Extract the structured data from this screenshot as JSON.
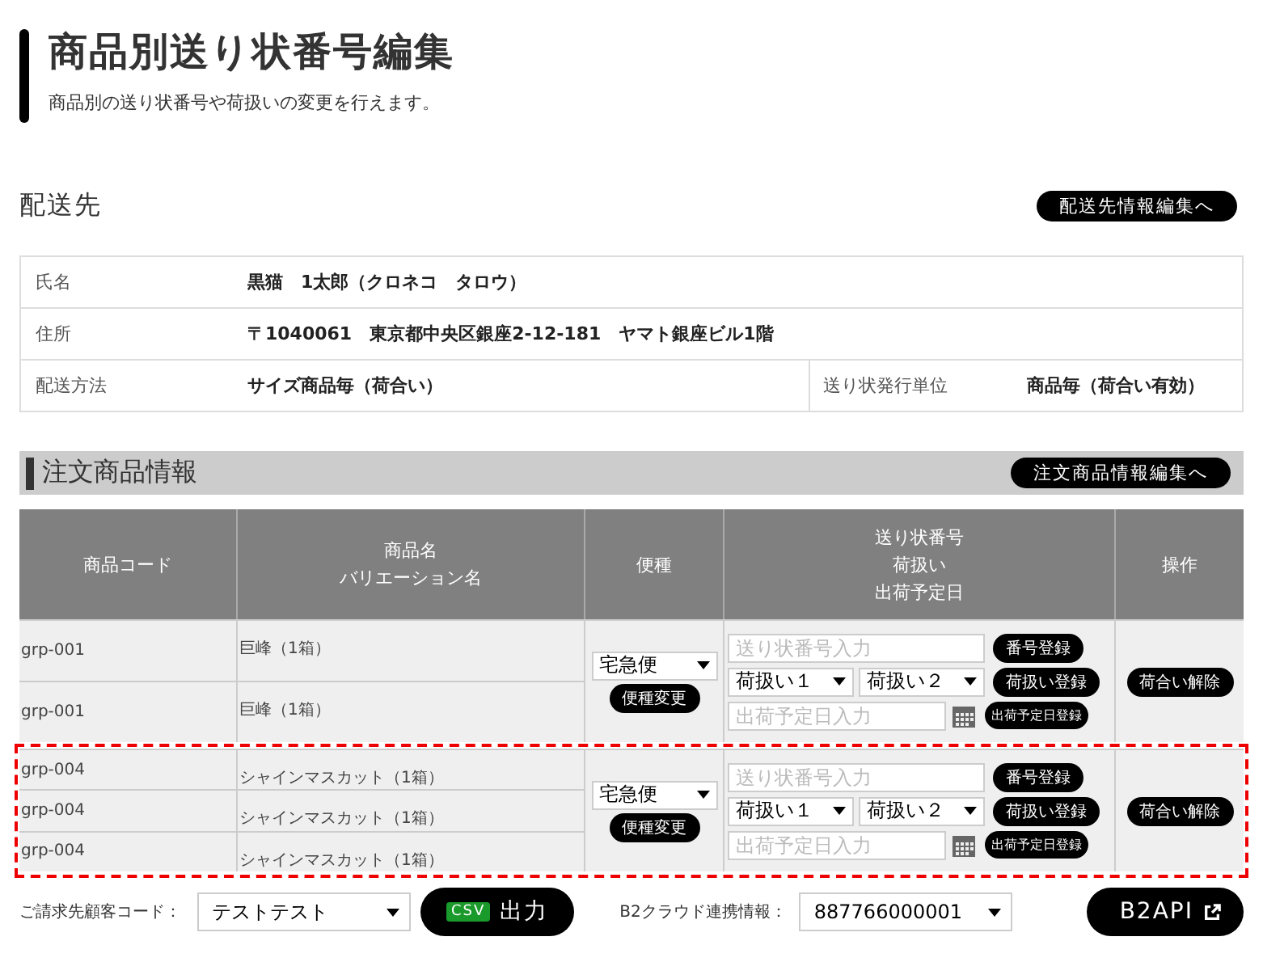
{
  "header": {
    "title": "商品別送り状番号編集",
    "subtitle": "商品別の送り状番号や荷扱いの変更を行えます。"
  },
  "destination": {
    "heading": "配送先",
    "edit_button": "配送先情報編集へ",
    "rows": [
      {
        "label": "氏名",
        "value": "黒猫　1太郎（クロネコ　タロウ）"
      },
      {
        "label": "住所",
        "value": "〒1040061　東京都中央区銀座2-12-181　ヤマト銀座ビル1階"
      },
      {
        "label": "配送方法",
        "value": "サイズ商品毎（荷合い）",
        "label_2": "送り状発行単位",
        "value_2": "商品毎（荷合い有効）"
      }
    ]
  },
  "order": {
    "heading": "注文商品情報",
    "edit_button": "注文商品情報編集へ",
    "columns": [
      [
        "商品コード"
      ],
      [
        "商品名",
        "バリエーション名"
      ],
      [
        "便種"
      ],
      [
        "送り状番号",
        "荷扱い",
        "出荷予定日"
      ],
      [
        "操作"
      ]
    ],
    "groups": [
      {
        "highlighted": false,
        "rows": [
          {
            "code": "grp-001",
            "name": "巨峰（1箱）"
          },
          {
            "code": "grp-001",
            "name": "巨峰（1箱）"
          }
        ],
        "delivery_type": "宅急便",
        "change_button": "便種変更",
        "tracking_placeholder": "送り状番号入力",
        "tracking_button": "番号登録",
        "handling_1": "荷扱い１",
        "handling_2": "荷扱い２",
        "handling_button": "荷扱い登録",
        "date_placeholder": "出荷予定日入力",
        "date_button": "出荷予定日登録",
        "unbundle_button": "荷合い解除"
      },
      {
        "highlighted": true,
        "rows": [
          {
            "code": "grp-004",
            "name": "シャインマスカット（1箱）"
          },
          {
            "code": "grp-004",
            "name": "シャインマスカット（1箱）"
          },
          {
            "code": "grp-004",
            "name": "シャインマスカット（1箱）"
          }
        ],
        "delivery_type": "宅急便",
        "change_button": "便種変更",
        "tracking_placeholder": "送り状番号入力",
        "tracking_button": "番号登録",
        "handling_1": "荷扱い１",
        "handling_2": "荷扱い２",
        "handling_button": "荷扱い登録",
        "date_placeholder": "出荷予定日入力",
        "date_button": "出荷予定日登録",
        "unbundle_button": "荷合い解除"
      }
    ]
  },
  "footer": {
    "customer_label": "ご請求先顧客コード：",
    "customer_value": "テストテスト",
    "csv_badge": "CSV",
    "csv_button": "出力",
    "b2_label": "B2クラウド連携情報：",
    "b2_value": "887766000001",
    "b2_button": "B2API"
  }
}
